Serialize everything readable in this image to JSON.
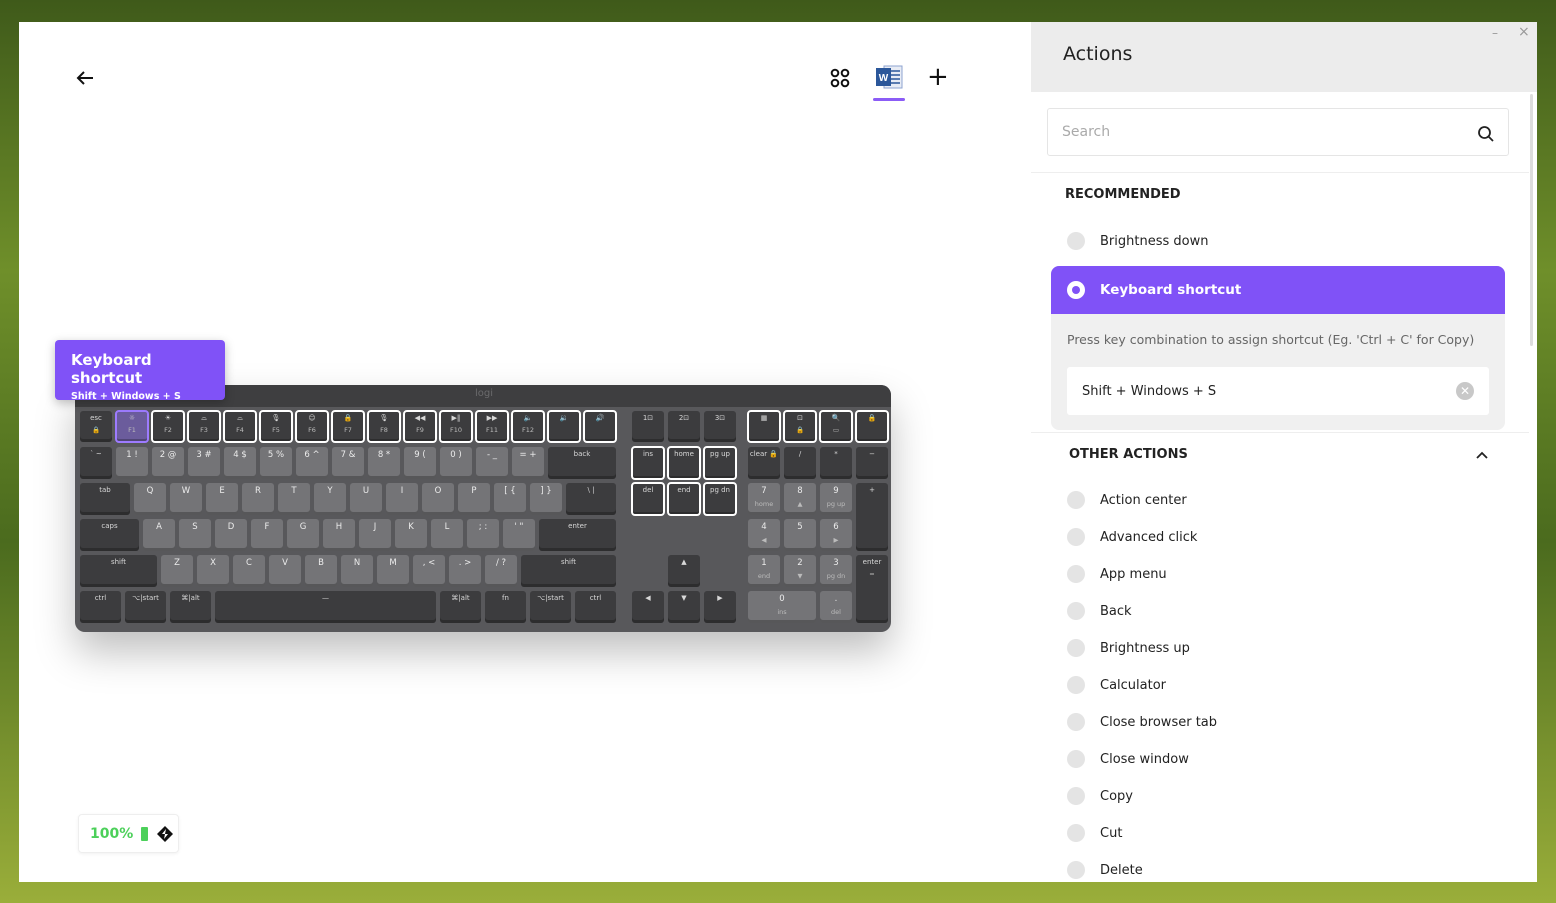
{
  "toolbar": {
    "back_icon": "arrow-left-icon",
    "apps_icon": "grid-circles-icon",
    "app_selected": "Microsoft Word",
    "add_icon": "plus-icon",
    "plus": "+"
  },
  "tooltip": {
    "title": "Keyboard shortcut",
    "subtitle": "Shift + Windows + S"
  },
  "keyboard": {
    "logo": "logi",
    "main": [
      [
        [
          "esc",
          "🔒",
          "d"
        ],
        [
          "☼",
          "F1",
          "s"
        ],
        [
          "☀",
          "F2",
          "o"
        ],
        [
          "⌓",
          "F3",
          "o"
        ],
        [
          "⌓",
          "F4",
          "o"
        ],
        [
          "🎙",
          "F5",
          "o"
        ],
        [
          "☺",
          "F6",
          "o"
        ],
        [
          "🔒",
          "F7",
          "o"
        ],
        [
          "🎙",
          "F8",
          "o"
        ],
        [
          "◀◀",
          "F9",
          "o"
        ],
        [
          "▶‖",
          "F10",
          "o"
        ],
        [
          "▶▶",
          "F11",
          "o"
        ],
        [
          "🔈",
          "F12",
          "o"
        ],
        [
          "🔉",
          "",
          "o"
        ],
        [
          "🔊",
          "",
          "o"
        ]
      ],
      [
        [
          "` ~",
          "",
          "d"
        ],
        [
          "1 !",
          "",
          "l"
        ],
        [
          "2 @",
          "",
          "l"
        ],
        [
          "3 #",
          "",
          "l"
        ],
        [
          "4 $",
          "",
          "l"
        ],
        [
          "5 %",
          "",
          "l"
        ],
        [
          "6 ^",
          "",
          "l"
        ],
        [
          "7 &",
          "",
          "l"
        ],
        [
          "8 *",
          "",
          "l"
        ],
        [
          "9 (",
          "",
          "l"
        ],
        [
          "0 )",
          "",
          "l"
        ],
        [
          "- _",
          "",
          "l"
        ],
        [
          "= +",
          "",
          "l"
        ],
        [
          "back",
          "",
          "d"
        ]
      ],
      [
        [
          "tab",
          "",
          "d"
        ],
        [
          "Q",
          "",
          "l"
        ],
        [
          "W",
          "",
          "l"
        ],
        [
          "E",
          "",
          "l"
        ],
        [
          "R",
          "",
          "l"
        ],
        [
          "T",
          "",
          "l"
        ],
        [
          "Y",
          "",
          "l"
        ],
        [
          "U",
          "",
          "l"
        ],
        [
          "I",
          "",
          "l"
        ],
        [
          "O",
          "",
          "l"
        ],
        [
          "P",
          "",
          "l"
        ],
        [
          "[ {",
          "",
          "l"
        ],
        [
          "] }",
          "",
          "l"
        ],
        [
          "\\ |",
          "",
          "d"
        ]
      ],
      [
        [
          "caps",
          "",
          "d"
        ],
        [
          "A",
          "",
          "l"
        ],
        [
          "S",
          "",
          "l"
        ],
        [
          "D",
          "",
          "l"
        ],
        [
          "F",
          "",
          "l"
        ],
        [
          "G",
          "",
          "l"
        ],
        [
          "H",
          "",
          "l"
        ],
        [
          "J",
          "",
          "l"
        ],
        [
          "K",
          "",
          "l"
        ],
        [
          "L",
          "",
          "l"
        ],
        [
          "; :",
          "",
          "l"
        ],
        [
          "' \"",
          "",
          "l"
        ],
        [
          "enter",
          "",
          "d"
        ]
      ],
      [
        [
          "shift",
          "",
          "d"
        ],
        [
          "Z",
          "",
          "l"
        ],
        [
          "X",
          "",
          "l"
        ],
        [
          "C",
          "",
          "l"
        ],
        [
          "V",
          "",
          "l"
        ],
        [
          "B",
          "",
          "l"
        ],
        [
          "N",
          "",
          "l"
        ],
        [
          "M",
          "",
          "l"
        ],
        [
          ", <",
          "",
          "l"
        ],
        [
          ". >",
          "",
          "l"
        ],
        [
          "/ ?",
          "",
          "l"
        ],
        [
          "shift",
          "",
          "d"
        ]
      ],
      [
        [
          "ctrl",
          "",
          "d"
        ],
        [
          "⌥|start",
          "",
          "d"
        ],
        [
          "⌘|alt",
          "",
          "d"
        ],
        [
          "—",
          "",
          "d"
        ],
        [
          "⌘|alt",
          "",
          "d"
        ],
        [
          "fn",
          "",
          "d"
        ],
        [
          "⌥|start",
          "",
          "d"
        ],
        [
          "ctrl",
          "",
          "d"
        ]
      ]
    ],
    "nav": [
      [
        [
          "1⊡",
          "",
          "d"
        ],
        [
          "2⊡",
          "",
          "d"
        ],
        [
          "3⊡",
          "",
          "d"
        ]
      ],
      [
        [
          "ins",
          "",
          "o"
        ],
        [
          "home",
          "",
          "o"
        ],
        [
          "pg up",
          "",
          "o"
        ]
      ],
      [
        [
          "del",
          "",
          "o"
        ],
        [
          "end",
          "",
          "o"
        ],
        [
          "pg dn",
          "",
          "o"
        ]
      ],
      [],
      [
        [
          "▲",
          "",
          "d"
        ]
      ],
      [
        [
          "◀",
          "",
          "d"
        ],
        [
          "▼",
          "",
          "d"
        ],
        [
          "▶",
          "",
          "d"
        ]
      ]
    ],
    "numpad": [
      [
        [
          "▦",
          "",
          "o"
        ],
        [
          "⊡",
          "🔒",
          "o"
        ],
        [
          "🔍",
          "▭",
          "o"
        ],
        [
          "🔒",
          "",
          "o"
        ]
      ],
      [
        [
          "clear 🔒",
          "",
          "d"
        ],
        [
          "/",
          "",
          "d"
        ],
        [
          "*",
          "",
          "d"
        ],
        [
          "−",
          "",
          "d"
        ]
      ],
      [
        [
          "7",
          "home",
          "l"
        ],
        [
          "8",
          "▲",
          "l"
        ],
        [
          "9",
          "pg up",
          "l"
        ],
        [
          "+",
          "",
          "d"
        ]
      ],
      [
        [
          "4",
          "◀",
          "l"
        ],
        [
          "5",
          "",
          "l"
        ],
        [
          "6",
          "▶",
          "l"
        ]
      ],
      [
        [
          "1",
          "end",
          "l"
        ],
        [
          "2",
          "▼",
          "l"
        ],
        [
          "3",
          "pg dn",
          "l"
        ],
        [
          "enter",
          "=",
          "d"
        ]
      ],
      [
        [
          "0",
          "ins",
          "l"
        ],
        [
          ".",
          "del",
          "l"
        ]
      ]
    ]
  },
  "battery": {
    "percent": "100%",
    "color": "#4cd05a",
    "connection_icon": "logi-bolt-icon"
  },
  "panel": {
    "title": "Actions",
    "minimize": "–",
    "close": "×",
    "search_placeholder": "Search",
    "recommended_label": "RECOMMENDED",
    "recommended": [
      "Brightness down"
    ],
    "selected": {
      "label": "Keyboard shortcut",
      "hint": "Press key combination to assign shortcut (Eg. 'Ctrl + C' for Copy)",
      "value": "Shift + Windows + S"
    },
    "other_label": "OTHER ACTIONS",
    "other": [
      "Action center",
      "Advanced click",
      "App menu",
      "Back",
      "Brightness up",
      "Calculator",
      "Close browser tab",
      "Close window",
      "Copy",
      "Cut",
      "Delete"
    ]
  },
  "colors": {
    "accent": "#8052f7"
  }
}
